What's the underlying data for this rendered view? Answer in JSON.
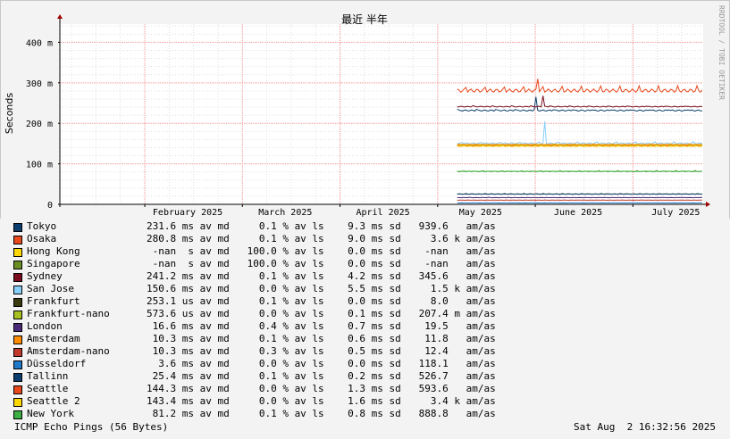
{
  "chart_data": {
    "type": "line",
    "title": "最近 半年",
    "ylabel": "Seconds",
    "watermark": "RRDTOOL / TOBI OETIKER",
    "y_ticks": [
      "0",
      "100 m",
      "200 m",
      "300 m",
      "400 m"
    ],
    "y_tick_values": [
      0,
      100,
      200,
      300,
      400
    ],
    "ylim": [
      0,
      445
    ],
    "x_ticks": [
      "February 2025",
      "March 2025",
      "April 2025",
      "May 2025",
      "June 2025",
      "July 2025"
    ],
    "x_tick_months": [
      1,
      2,
      3,
      4,
      5,
      6
    ],
    "xlim_months": [
      0.13,
      6.72
    ],
    "data_start_month": 4.2,
    "grid": true,
    "colors": {
      "background": "#f3f3f3",
      "canvas": "#ffffff",
      "major_grid": "#ff9a9a",
      "minor_grid": "#e0e0e0",
      "axis_arrow": "#a00000"
    },
    "series": [
      {
        "name": "Tokyo",
        "color": "#0b3d6e",
        "avg": 231.6,
        "jitter": 3,
        "spike": 265
      },
      {
        "name": "Osaka",
        "color": "#e8481c",
        "avg": 280.8,
        "jitter": 8,
        "spike": 310
      },
      {
        "name": "Hong Kong",
        "color": "#ffd700",
        "avg": 145,
        "jitter": 1,
        "spike": 0
      },
      {
        "name": "Singapore",
        "color": "#6b8e23",
        "avg": 81.2,
        "jitter": 1.5,
        "spike": 0
      },
      {
        "name": "Sydney",
        "color": "#7a0a1e",
        "avg": 241.2,
        "jitter": 2,
        "spike": 268
      },
      {
        "name": "San Jose",
        "color": "#87cefa",
        "avg": 150.6,
        "jitter": 3,
        "spike": 205
      },
      {
        "name": "Frankfurt",
        "color": "#3b3b10",
        "avg": 25.3,
        "jitter": 0.5,
        "spike": 0
      },
      {
        "name": "Frankfurt-nano",
        "color": "#a8c020",
        "avg": 146.5,
        "jitter": 1,
        "spike": 0
      },
      {
        "name": "London",
        "color": "#4b2a7a",
        "avg": 16.6,
        "jitter": 0.5,
        "spike": 0
      },
      {
        "name": "Amsterdam",
        "color": "#ff8c00",
        "avg": 148,
        "jitter": 1,
        "spike": 0
      },
      {
        "name": "Amsterdam-nano",
        "color": "#c0392b",
        "avg": 10.3,
        "jitter": 0.4,
        "spike": 0
      },
      {
        "name": "Düsseldorf",
        "color": "#1f78c8",
        "avg": 3.6,
        "jitter": 0.3,
        "spike": 0
      },
      {
        "name": "Tallinn",
        "color": "#0b3d6e",
        "avg": 25.4,
        "jitter": 0.8,
        "spike": 0
      },
      {
        "name": "Seattle",
        "color": "#e8481c",
        "avg": 144.3,
        "jitter": 1,
        "spike": 0
      },
      {
        "name": "Seattle 2",
        "color": "#ffd700",
        "avg": 143.4,
        "jitter": 1,
        "spike": 0
      },
      {
        "name": "New York",
        "color": "#3cb043",
        "avg": 81.2,
        "jitter": 1,
        "spike": 0
      }
    ]
  },
  "legend": [
    {
      "name": "Tokyo",
      "stats": "231.6 ms av md     0.1 % av ls    9.3 ms sd   939.6   am/as"
    },
    {
      "name": "Osaka",
      "stats": "280.8 ms av md     0.1 % av ls    9.0 ms sd     3.6 k am/as"
    },
    {
      "name": "Hong Kong",
      "stats": " -nan  s av md   100.0 % av ls    0.0 ms sd    -nan   am/as"
    },
    {
      "name": "Singapore",
      "stats": " -nan  s av md   100.0 % av ls    0.0 ms sd    -nan   am/as"
    },
    {
      "name": "Sydney",
      "stats": "241.2 ms av md     0.1 % av ls    4.2 ms sd   345.6   am/as"
    },
    {
      "name": "San Jose",
      "stats": "150.6 ms av md     0.0 % av ls    5.5 ms sd     1.5 k am/as"
    },
    {
      "name": "Frankfurt",
      "stats": "253.1 us av md     0.1 % av ls    0.0 ms sd     8.0   am/as"
    },
    {
      "name": "Frankfurt-nano",
      "stats": "573.6 us av md     0.0 % av ls    0.1 ms sd   207.4 m am/as"
    },
    {
      "name": "London",
      "stats": " 16.6 ms av md     0.4 % av ls    0.7 ms sd    19.5   am/as"
    },
    {
      "name": "Amsterdam",
      "stats": " 10.3 ms av md     0.1 % av ls    0.6 ms sd    11.8   am/as"
    },
    {
      "name": "Amsterdam-nano",
      "stats": " 10.3 ms av md     0.3 % av ls    0.5 ms sd    12.4   am/as"
    },
    {
      "name": "Düsseldorf",
      "stats": "  3.6 ms av md     0.0 % av ls    0.0 ms sd   118.1   am/as"
    },
    {
      "name": "Tallinn",
      "stats": " 25.4 ms av md     0.1 % av ls    0.2 ms sd   526.7   am/as"
    },
    {
      "name": "Seattle",
      "stats": "144.3 ms av md     0.0 % av ls    1.3 ms sd   593.6   am/as"
    },
    {
      "name": "Seattle 2",
      "stats": "143.4 ms av md     0.0 % av ls    1.6 ms sd     3.4 k am/as"
    },
    {
      "name": "New York",
      "stats": " 81.2 ms av md     0.1 % av ls    0.8 ms sd   888.8   am/as"
    }
  ],
  "footer": {
    "left": "ICMP Echo Pings (56 Bytes)",
    "right": "Sat Aug  2 16:32:56 2025"
  }
}
